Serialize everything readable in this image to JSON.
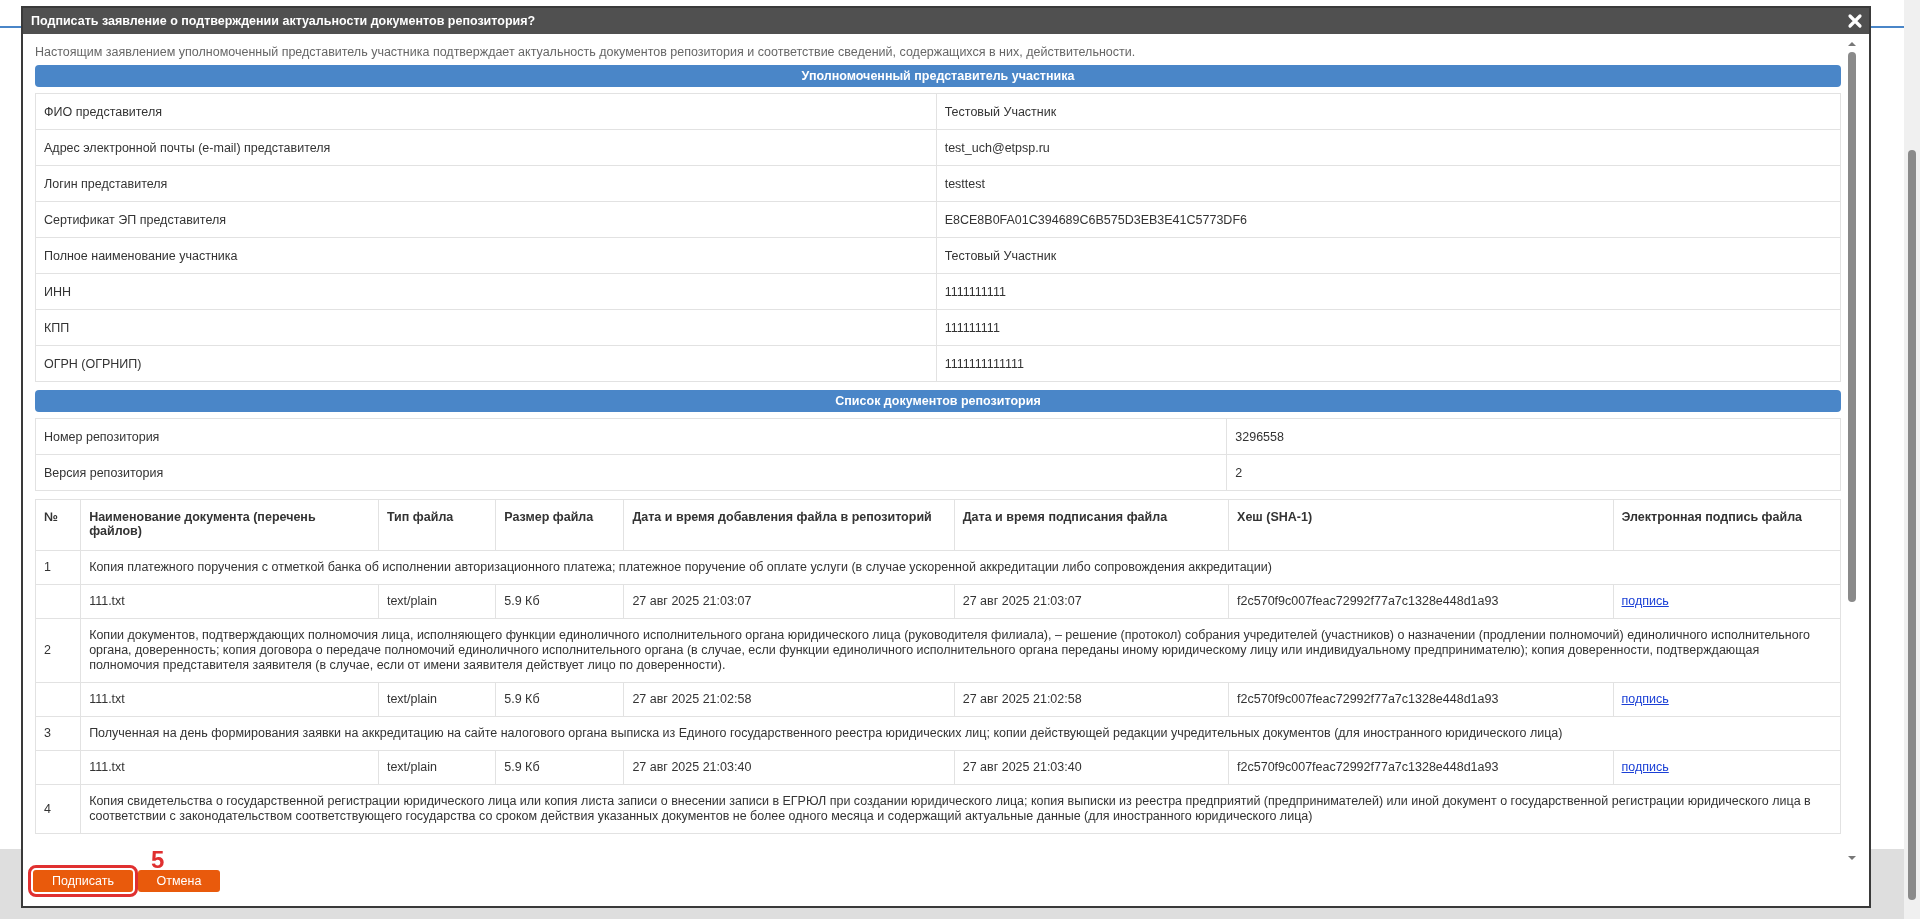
{
  "dialog": {
    "title": "Подписать заявление о подтверждении актуальности документов репозитория?",
    "intro": "Настоящим заявлением уполномоченный представитель участника подтверждает актуальность документов репозитория и соответствие сведений, содержащихся в них, действительности."
  },
  "representative_section": {
    "title": "Уполномоченный представитель участника",
    "rows": [
      {
        "label": "ФИО представителя",
        "value": "Тестовый Участник"
      },
      {
        "label": "Адрес электронной почты (e-mail) представителя",
        "value": "test_uch@etpsp.ru"
      },
      {
        "label": "Логин представителя",
        "value": "testtest"
      },
      {
        "label": "Сертификат ЭП представителя",
        "value": "E8CE8B0FA01C394689C6B575D3EB3E41C5773DF6"
      },
      {
        "label": "Полное наименование участника",
        "value": "Тестовый Участник"
      },
      {
        "label": "ИНН",
        "value": "1111111111"
      },
      {
        "label": "КПП",
        "value": "111111111"
      },
      {
        "label": "ОГРН (ОГРНИП)",
        "value": "1111111111111"
      }
    ]
  },
  "repository_section": {
    "title": "Список документов репозитория",
    "rows": [
      {
        "label": "Номер репозитория",
        "value": "3296558"
      },
      {
        "label": "Версия репозитория",
        "value": "2"
      }
    ],
    "documents": {
      "columns": [
        "№",
        "Наименование документа (перечень файлов)",
        "Тип файла",
        "Размер файла",
        "Дата и время добавления файла в репозиторий",
        "Дата и время подписания файла",
        "Хеш (SHA-1)",
        "Электронная подпись файла"
      ],
      "items": [
        {
          "number": "1",
          "name": "Копия платежного поручения с отметкой банка об исполнении авторизационного платежа; платежное поручение об оплате услуги (в случае ускоренной аккредитации либо сопровождения аккредитации)",
          "files": [
            {
              "name": "111.txt",
              "type": "text/plain",
              "size": "5.9 Кб",
              "added": "27 авг 2025 21:03:07",
              "signed": "27 авг 2025 21:03:07",
              "hash": "f2c570f9c007feac72992f77a7c1328e448d1a93",
              "signature": "подпись"
            }
          ]
        },
        {
          "number": "2",
          "name": "Копии документов, подтверждающих полномочия лица, исполняющего функции единоличного исполнительного органа юридического лица (руководителя филиала), – решение (протокол) собрания учредителей (участников) о назначении (продлении полномочий) единоличного исполнительного органа, доверенность; копия договора о передаче полномочий единоличного исполнительного органа (в случае, если функции единоличного исполнительного органа переданы иному юридическому лицу или индивидуальному предпринимателю); копия доверенности, подтверждающая полномочия представителя заявителя (в случае, если от имени заявителя действует лицо по доверенности).",
          "files": [
            {
              "name": "111.txt",
              "type": "text/plain",
              "size": "5.9 Кб",
              "added": "27 авг 2025 21:02:58",
              "signed": "27 авг 2025 21:02:58",
              "hash": "f2c570f9c007feac72992f77a7c1328e448d1a93",
              "signature": "подпись"
            }
          ]
        },
        {
          "number": "3",
          "name": "Полученная на день формирования заявки на аккредитацию на сайте налогового органа выписка из Единого государственного реестра юридических лиц; копии действующей редакции учредительных документов (для иностранного юридического лица)",
          "files": [
            {
              "name": "111.txt",
              "type": "text/plain",
              "size": "5.9 Кб",
              "added": "27 авг 2025 21:03:40",
              "signed": "27 авг 2025 21:03:40",
              "hash": "f2c570f9c007feac72992f77a7c1328e448d1a93",
              "signature": "подпись"
            }
          ]
        },
        {
          "number": "4",
          "name": "Копия свидетельства о государственной регистрации юридического лица или копия листа записи о внесении записи в ЕГРЮЛ при создании юридического лица; копия выписки из реестра предприятий (предпринимателей) или иной документ о государственной регистрации юридического лица в соответствии с законодательством соответствующего государства со сроком действия указанных документов не более одного месяца и содержащий актуальные данные (для иностранного юридического лица)"
        }
      ]
    }
  },
  "buttons": [
    {
      "label": "Подписать",
      "kind": "primary",
      "highlighted": true
    },
    {
      "label": "Отмена",
      "kind": "secondary",
      "highlighted": false
    }
  ],
  "annotation": {
    "label": "5"
  }
}
